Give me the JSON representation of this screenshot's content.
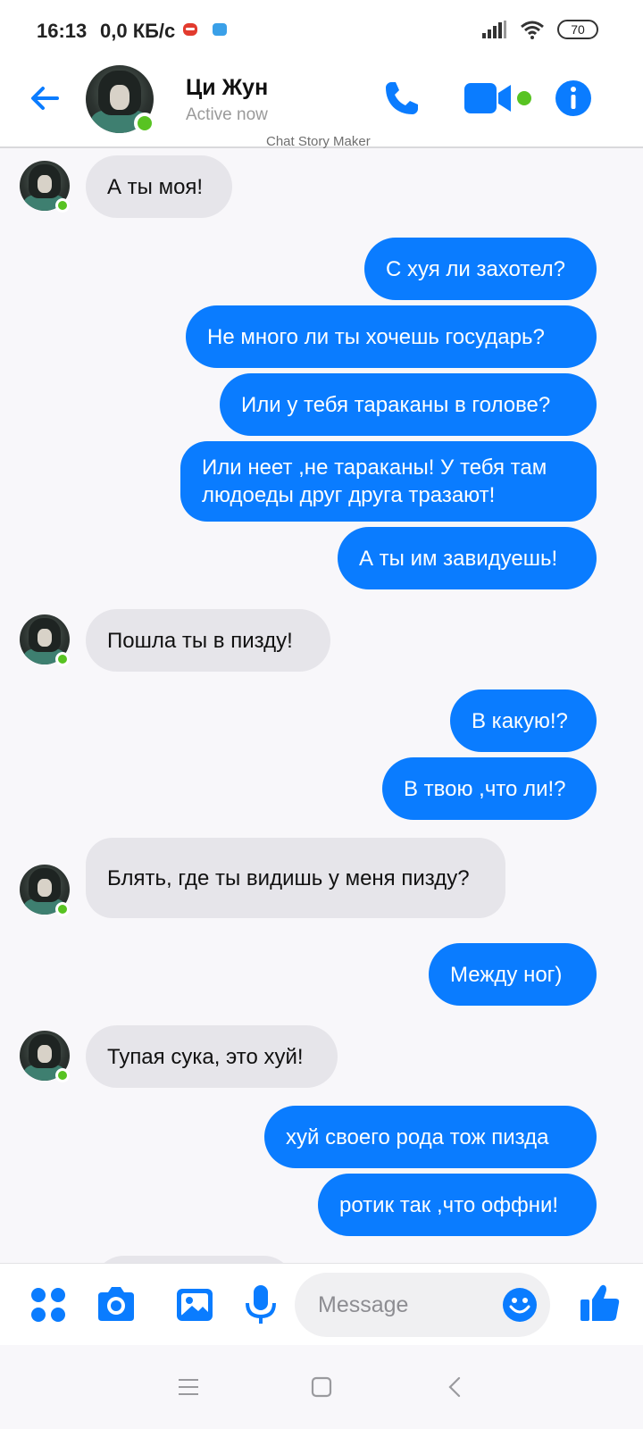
{
  "status_bar": {
    "time": "16:13",
    "network_speed": "0,0 КБ/с",
    "battery": "70",
    "icons": [
      "app-notification-icon",
      "game-notification-icon",
      "signal-icon",
      "wifi-icon",
      "battery-icon"
    ]
  },
  "header": {
    "contact_name": "Ци Жун",
    "status": "Active now",
    "watermark": "Chat Story Maker",
    "icons": [
      "back-arrow-icon",
      "phone-icon",
      "video-camera-icon",
      "info-icon"
    ],
    "accent_color": "#0a7cff",
    "online_color": "#58c322"
  },
  "messages": [
    {
      "side": "in",
      "text": "А ты моя!"
    },
    {
      "side": "out",
      "text": "С хуя ли захотел?"
    },
    {
      "side": "out",
      "text": "Не много ли ты хочешь государь?"
    },
    {
      "side": "out",
      "text": "Или у тебя тараканы в голове?"
    },
    {
      "side": "out",
      "text": "Или неет ,не тараканы! У тебя там людоеды друг друга тразают!"
    },
    {
      "side": "out",
      "text": "А ты им завидуешь!"
    },
    {
      "side": "in",
      "text": "Пошла ты в пизду!"
    },
    {
      "side": "out",
      "text": "В какую!?"
    },
    {
      "side": "out",
      "text": "В твою ,что ли!?"
    },
    {
      "side": "in",
      "text": "Блять, где ты видишь у меня пизду?"
    },
    {
      "side": "out",
      "text": "Между ног)"
    },
    {
      "side": "in",
      "text": "Тупая сука, это хуй!"
    },
    {
      "side": "out",
      "text": "хуй своего рода тож пизда"
    },
    {
      "side": "out",
      "text": "ротик так ,что оффни!"
    }
  ],
  "composer": {
    "placeholder": "Message",
    "icons": [
      "apps-grid-icon",
      "camera-icon",
      "gallery-icon",
      "microphone-icon",
      "emoji-icon",
      "thumbs-up-icon"
    ]
  },
  "navigation": {
    "icons": [
      "menu-icon",
      "home-icon",
      "back-icon"
    ]
  }
}
